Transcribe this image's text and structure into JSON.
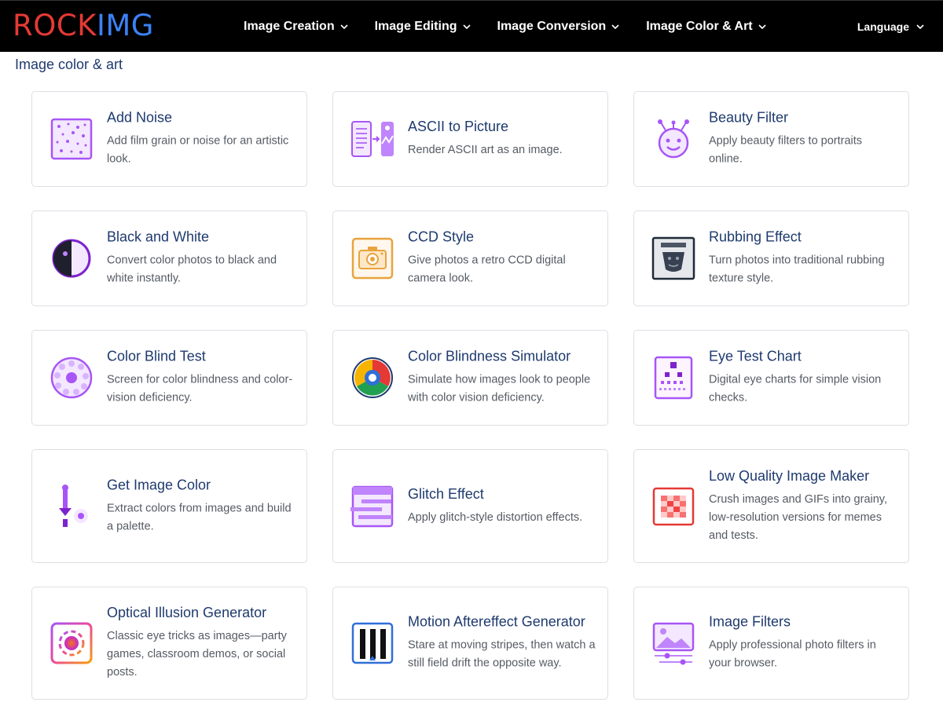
{
  "brand": {
    "part1": "ROCK",
    "part2": "IMG"
  },
  "nav": [
    {
      "label": "Image Creation"
    },
    {
      "label": "Image Editing"
    },
    {
      "label": "Image Conversion"
    },
    {
      "label": "Image Color & Art"
    }
  ],
  "language_label": "Language",
  "section_title": "Image color & art",
  "colors": {
    "accent": "#a855f7",
    "title": "#1e3a6e",
    "brand_red": "#e53935",
    "brand_blue": "#3b82f6"
  },
  "tools": [
    {
      "title": "Add Noise",
      "desc": "Add film grain or noise for an artistic look.",
      "icon": "noise-icon"
    },
    {
      "title": "ASCII to Picture",
      "desc": "Render ASCII art as an image.",
      "icon": "ascii-icon"
    },
    {
      "title": "Beauty Filter",
      "desc": "Apply beauty filters to portraits online.",
      "icon": "face-icon"
    },
    {
      "title": "Black and White",
      "desc": "Convert color photos to black and white instantly.",
      "icon": "contrast-icon"
    },
    {
      "title": "CCD Style",
      "desc": "Give photos a retro CCD digital camera look.",
      "icon": "camera-icon"
    },
    {
      "title": "Rubbing Effect",
      "desc": "Turn photos into traditional rubbing texture style.",
      "icon": "rubbing-icon"
    },
    {
      "title": "Color Blind Test",
      "desc": "Screen for color blindness and color-vision deficiency.",
      "icon": "dot-plate-icon"
    },
    {
      "title": "Color Blindness Simulator",
      "desc": "Simulate how images look to people with color vision deficiency.",
      "icon": "color-wheel-icon"
    },
    {
      "title": "Eye Test Chart",
      "desc": "Digital eye charts for simple vision checks.",
      "icon": "eye-chart-icon"
    },
    {
      "title": "Get Image Color",
      "desc": "Extract colors from images and build a palette.",
      "icon": "eyedropper-icon"
    },
    {
      "title": "Glitch Effect",
      "desc": "Apply glitch-style distortion effects.",
      "icon": "glitch-icon"
    },
    {
      "title": "Low Quality Image Maker",
      "desc": "Crush images and GIFs into grainy, low-resolution versions for memes and tests.",
      "icon": "pixelate-icon"
    },
    {
      "title": "Optical Illusion Generator",
      "desc": "Classic eye tricks as images—party games, classroom demos, or social posts.",
      "icon": "illusion-icon"
    },
    {
      "title": "Motion Aftereffect Generator",
      "desc": "Stare at moving stripes, then watch a still field drift the opposite way.",
      "icon": "stripes-icon"
    },
    {
      "title": "Image Filters",
      "desc": "Apply professional photo filters in your browser.",
      "icon": "filter-sliders-icon"
    }
  ]
}
